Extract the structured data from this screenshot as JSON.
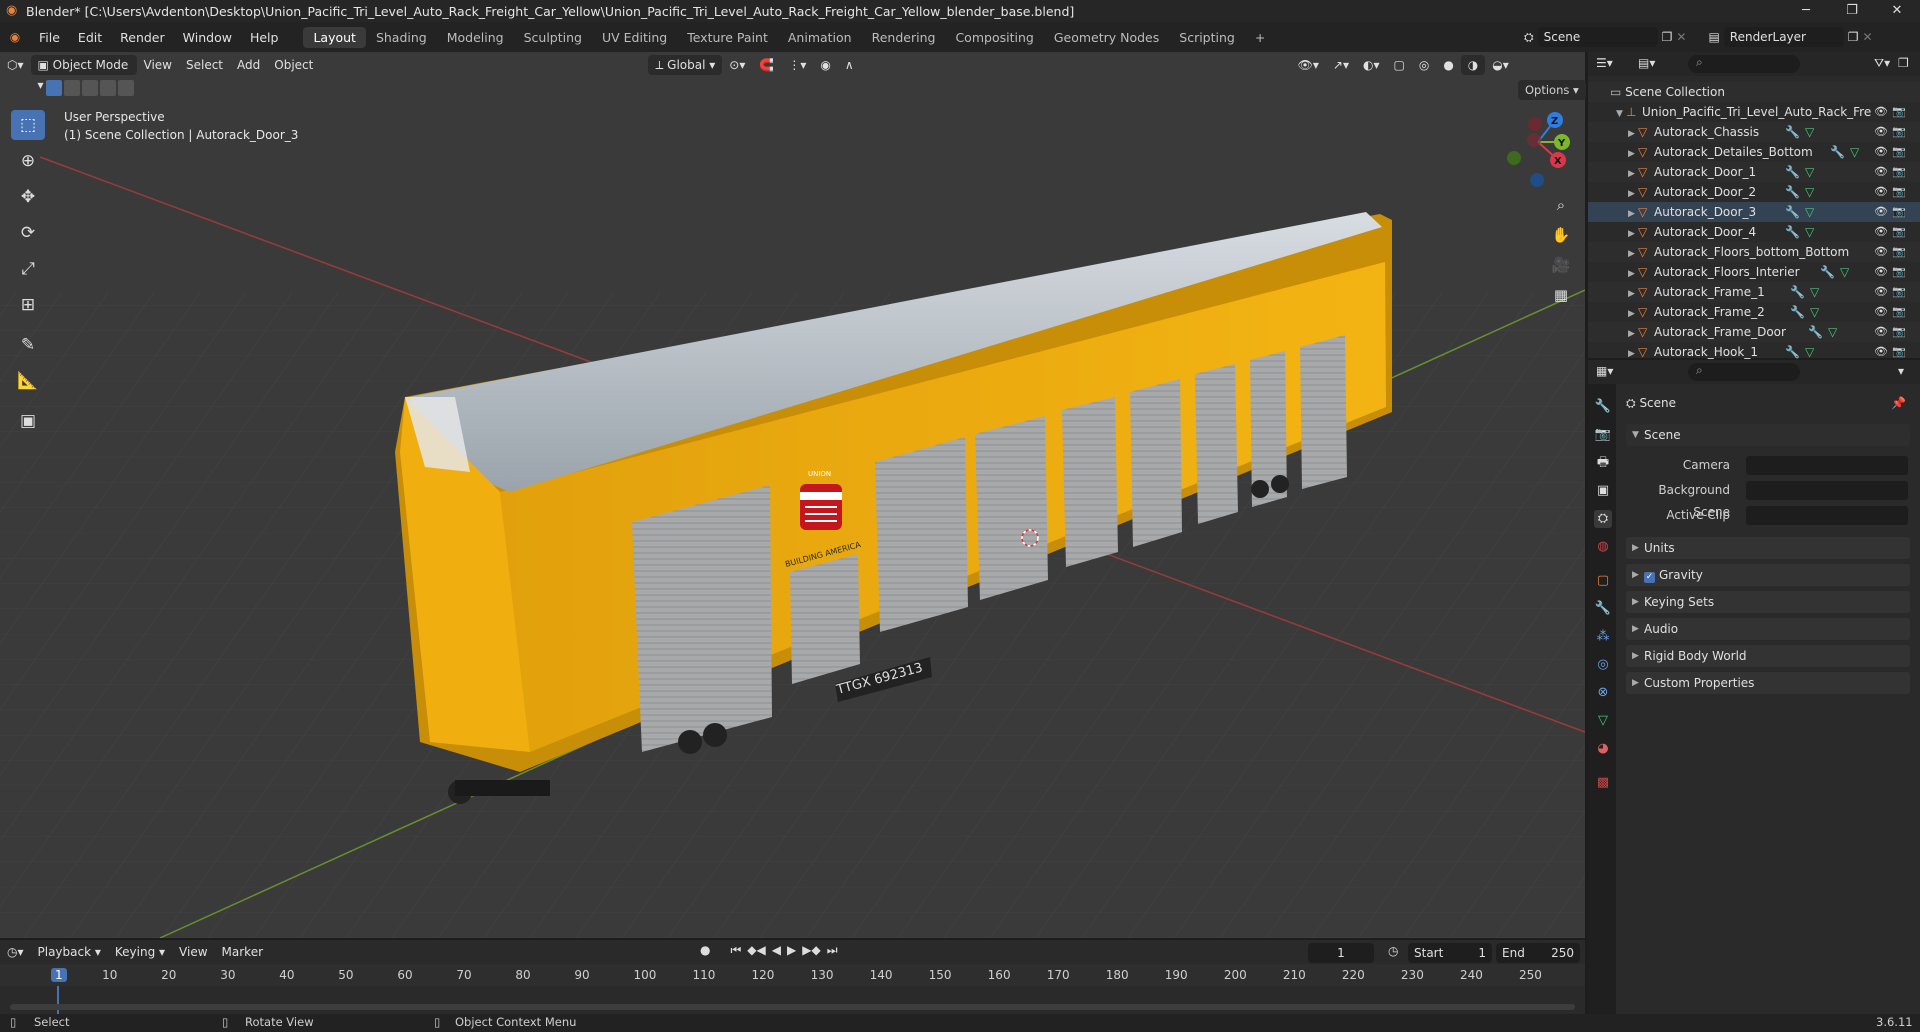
{
  "window": {
    "title": "Blender* [C:\\Users\\Avdenton\\Desktop\\Union_Pacific_Tri_Level_Auto_Rack_Freight_Car_Yellow\\Union_Pacific_Tri_Level_Auto_Rack_Freight_Car_Yellow_blender_base.blend]"
  },
  "menu": [
    "File",
    "Edit",
    "Render",
    "Window",
    "Help"
  ],
  "workspaces": [
    {
      "label": "Layout",
      "active": true
    },
    {
      "label": "Shading"
    },
    {
      "label": "Modeling"
    },
    {
      "label": "Sculpting"
    },
    {
      "label": "UV Editing"
    },
    {
      "label": "Texture Paint"
    },
    {
      "label": "Animation"
    },
    {
      "label": "Rendering"
    },
    {
      "label": "Compositing"
    },
    {
      "label": "Geometry Nodes"
    },
    {
      "label": "Scripting"
    },
    {
      "label": "+"
    }
  ],
  "scene_field": "Scene",
  "renderlayer_field": "RenderLayer",
  "viewport": {
    "mode": "Object Mode",
    "menus": [
      "View",
      "Select",
      "Add",
      "Object"
    ],
    "transform": "Global",
    "options": "Options",
    "overlay_line1": "User Perspective",
    "overlay_line2": "(1) Scene Collection | Autorack_Door_3",
    "car_logo_line1": "UNION",
    "car_logo_line2": "PACIFIC",
    "car_slogan": "BUILDING AMERICA",
    "car_number": "TTGX 692313",
    "gizmo": {
      "x": "X",
      "y": "Y",
      "z": "Z"
    }
  },
  "outliner": {
    "root": "Scene Collection",
    "collection": "Union_Pacific_Tri_Level_Auto_Rack_Fre",
    "items": [
      "Autorack_Chassis",
      "Autorack_Detailes_Bottom",
      "Autorack_Door_1",
      "Autorack_Door_2",
      "Autorack_Door_3",
      "Autorack_Door_4",
      "Autorack_Floors_bottom_Bottom",
      "Autorack_Floors_Interier",
      "Autorack_Frame_1",
      "Autorack_Frame_2",
      "Autorack_Frame_Door",
      "Autorack_Hook_1"
    ]
  },
  "properties": {
    "header": "Scene",
    "scene_panel": "Scene",
    "camera_label": "Camera",
    "bg_scene_label": "Background Scene",
    "active_clip_label": "Active Clip",
    "subpanels": [
      "Units",
      "Gravity",
      "Keying Sets",
      "Audio",
      "Rigid Body World",
      "Custom Properties"
    ]
  },
  "timeline": {
    "menus": [
      "Playback",
      "Keying",
      "View",
      "Marker"
    ],
    "current_frame": "1",
    "start_label": "Start",
    "start": "1",
    "end_label": "End",
    "end": "250",
    "ticks": [
      "1",
      "10",
      "20",
      "30",
      "40",
      "50",
      "60",
      "70",
      "80",
      "90",
      "100",
      "110",
      "120",
      "130",
      "140",
      "150",
      "160",
      "170",
      "180",
      "190",
      "200",
      "210",
      "220",
      "230",
      "240",
      "250"
    ]
  },
  "statusbar": {
    "select": "Select",
    "rotate": "Rotate View",
    "context": "Object Context Menu",
    "version": "3.6.11"
  }
}
